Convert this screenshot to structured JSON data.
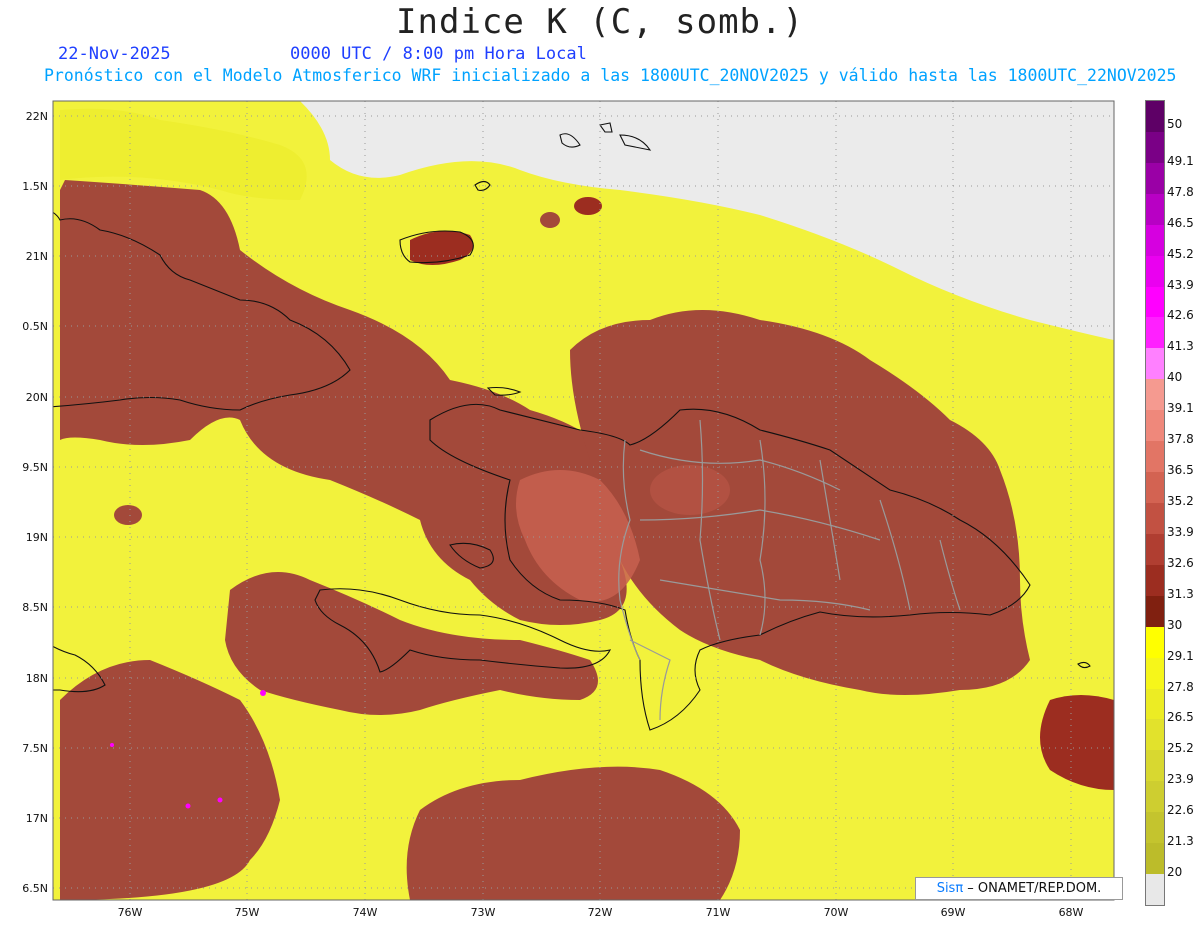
{
  "header": {
    "title": "Indice K (C, somb.)",
    "date": "22-Nov-2025",
    "time": "0000 UTC / 8:00 pm Hora Local",
    "description": "Pronóstico con el Modelo Atmosferico WRF inicializado a las 1800UTC_20NOV2025 y válido hasta las  1800UTC_22NOV2025"
  },
  "map": {
    "lat_labels": [
      "22N",
      "1.5N",
      "21N",
      "0.5N",
      "20N",
      "9.5N",
      "19N",
      "8.5N",
      "18N",
      "7.5N",
      "17N",
      "6.5N"
    ],
    "lon_labels": [
      "76W",
      "75W",
      "74W",
      "73W",
      "72W",
      "71W",
      "70W",
      "69W",
      "68W"
    ],
    "lat_range": [
      16.5,
      22
    ],
    "lon_range": [
      -76.6,
      -67.6
    ],
    "colors": {
      "ocean_low": "#f2f23c",
      "mid_brown": "#a3493a",
      "dark_brown": "#7a2416",
      "pinkish": "#c86050",
      "missing_gray": "#ebebeb",
      "coastline": "#111111",
      "province_lines": "#9a9a9a"
    }
  },
  "colorbar": {
    "labels": [
      "50",
      "49.1",
      "47.8",
      "46.5",
      "45.2",
      "43.9",
      "42.6",
      "41.3",
      "40",
      "39.1",
      "37.8",
      "36.5",
      "35.2",
      "33.9",
      "32.6",
      "31.3",
      "30",
      "29.1",
      "27.8",
      "26.5",
      "25.2",
      "23.9",
      "22.6",
      "21.3",
      "20"
    ],
    "colors": [
      "#5e0066",
      "#7a0086",
      "#9a00a6",
      "#b800c4",
      "#d600e0",
      "#ea00f0",
      "#ff00ff",
      "#ff20ff",
      "#ff80ff",
      "#f59a90",
      "#ef887b",
      "#e27565",
      "#d36352",
      "#c25142",
      "#b03e31",
      "#9c2d20",
      "#802010",
      "#ffff00",
      "#f6f61a",
      "#ecec24",
      "#e2e22c",
      "#d8d830",
      "#cece30",
      "#c4c42e",
      "#bcbc2a",
      "#e8e8e8"
    ]
  },
  "credit": {
    "sis": "Sisπ",
    "rest": " – ONAMET/REP.DOM."
  }
}
